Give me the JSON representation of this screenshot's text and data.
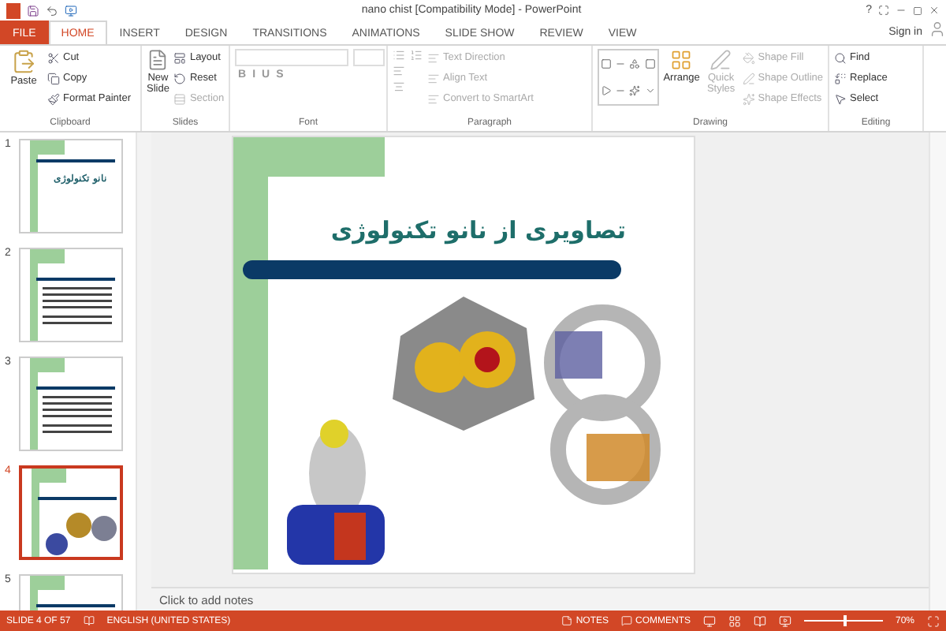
{
  "window": {
    "title": "nano chist [Compatibility Mode] - PowerPoint",
    "help": "?",
    "sign_in": "Sign in"
  },
  "tabs": [
    {
      "label": "FILE",
      "kind": "file",
      "selected": false
    },
    {
      "label": "HOME",
      "kind": "tab",
      "selected": true
    },
    {
      "label": "INSERT",
      "kind": "tab",
      "selected": false
    },
    {
      "label": "DESIGN",
      "kind": "tab",
      "selected": false
    },
    {
      "label": "TRANSITIONS",
      "kind": "tab",
      "selected": false
    },
    {
      "label": "ANIMATIONS",
      "kind": "tab",
      "selected": false
    },
    {
      "label": "SLIDE SHOW",
      "kind": "tab",
      "selected": false
    },
    {
      "label": "REVIEW",
      "kind": "tab",
      "selected": false
    },
    {
      "label": "VIEW",
      "kind": "tab",
      "selected": false
    }
  ],
  "ribbon": {
    "clipboard": {
      "label": "Clipboard",
      "paste": "Paste",
      "items": [
        {
          "label": "Cut",
          "disabled": false
        },
        {
          "label": "Copy",
          "disabled": false
        },
        {
          "label": "Format Painter",
          "disabled": false
        }
      ]
    },
    "slides": {
      "label": "Slides",
      "new_slide": "New Slide",
      "items": [
        {
          "label": "Layout",
          "disabled": false
        },
        {
          "label": "Reset",
          "disabled": false
        },
        {
          "label": "Section",
          "disabled": true
        }
      ]
    },
    "font": {
      "label": "Font",
      "buttons": [
        "B",
        "I",
        "U",
        "S"
      ]
    },
    "paragraph": {
      "label": "Paragraph",
      "items": [
        {
          "label": "Text Direction",
          "disabled": true
        },
        {
          "label": "Align Text",
          "disabled": true
        },
        {
          "label": "Convert to SmartArt",
          "disabled": true
        }
      ]
    },
    "drawing": {
      "label": "Drawing",
      "arrange": "Arrange",
      "quick_styles": "Quick Styles",
      "items": [
        {
          "label": "Shape Fill",
          "disabled": true
        },
        {
          "label": "Shape Outline",
          "disabled": true
        },
        {
          "label": "Shape Effects",
          "disabled": true
        }
      ]
    },
    "editing": {
      "label": "Editing",
      "items": [
        {
          "label": "Find",
          "disabled": false
        },
        {
          "label": "Replace",
          "disabled": false
        },
        {
          "label": "Select",
          "disabled": false
        }
      ]
    }
  },
  "thumbnails": [
    {
      "number": "1",
      "title": "نانو تکنولوژی",
      "kind": "title",
      "selected": false
    },
    {
      "number": "2",
      "kind": "text",
      "selected": false
    },
    {
      "number": "3",
      "kind": "text",
      "selected": false
    },
    {
      "number": "4",
      "kind": "pictures",
      "selected": true
    },
    {
      "number": "5",
      "kind": "partial",
      "selected": false
    }
  ],
  "slide": {
    "title": "تصاویری از نانو تکنولوژی"
  },
  "notes": {
    "placeholder": "Click to add notes"
  },
  "status_bar": {
    "slide": "SLIDE 4 OF 57",
    "language": "ENGLISH (UNITED STATES)",
    "notes": "NOTES",
    "comments": "COMMENTS",
    "zoom_slider": {
      "level": 0.5
    },
    "zoom": "70%"
  }
}
